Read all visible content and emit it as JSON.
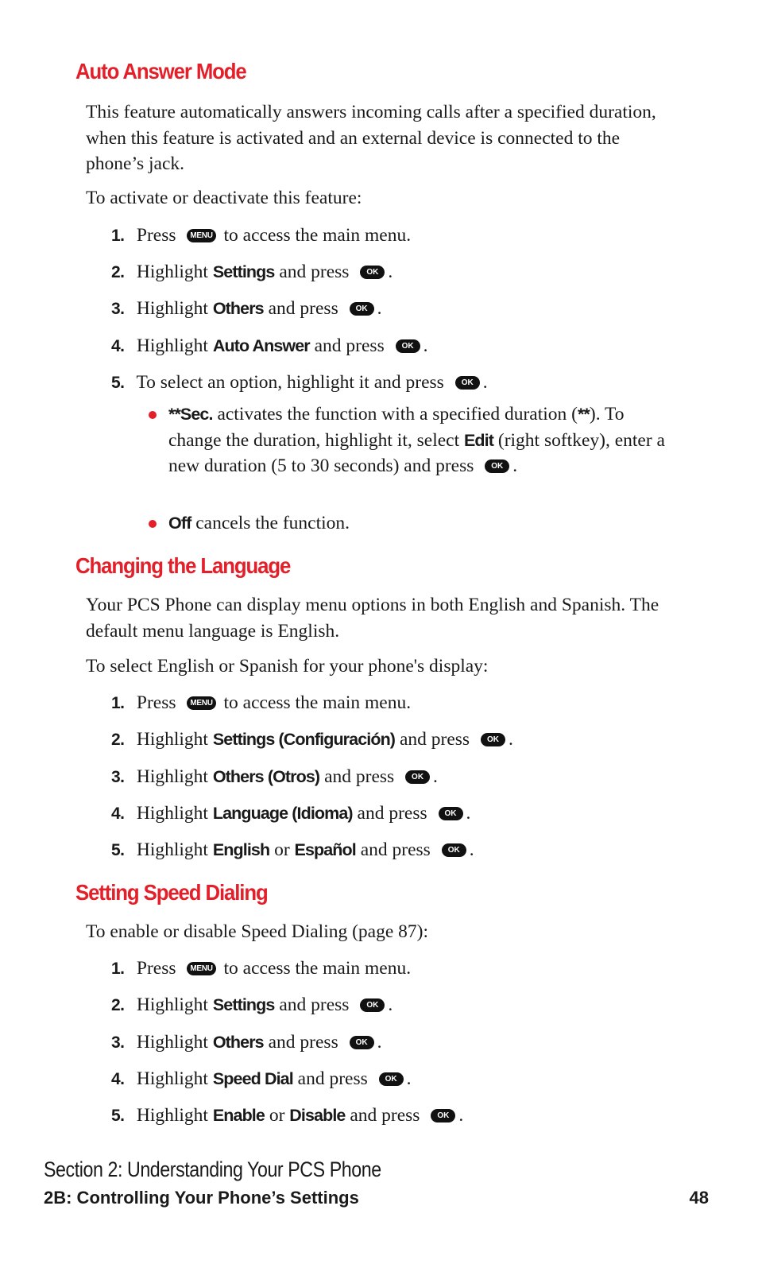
{
  "keys": {
    "menu": "MENU",
    "ok": "OK"
  },
  "sections": [
    {
      "title": "Auto Answer Mode",
      "intro": "This feature automatically answers incoming calls after a specified duration, when this feature is activated and an external device is connected to the phone’s jack.",
      "lead": "To activate or deactivate this feature:",
      "steps": [
        {
          "num": "1.",
          "pre": "Press",
          "post": "to access the main menu."
        },
        {
          "num": "2.",
          "pre": "Highlight",
          "bold": "Settings",
          "post": "and press"
        },
        {
          "num": "3.",
          "pre": "Highlight",
          "bold": "Others",
          "post": "and press"
        },
        {
          "num": "4.",
          "pre": "Highlight",
          "bold": "Auto Answer",
          "post": "and press"
        },
        {
          "num": "5.",
          "pre": "To select an option, highlight it and press"
        }
      ],
      "bullets": [
        {
          "bold": "**Sec.",
          "text1": "activates the function with a specified duration (",
          "bold2": "**",
          "text2": "). To change the duration, highlight it, select",
          "bold3": "Edit",
          "text3": "(right softkey), enter a new duration (5 to 30 seconds) and press"
        },
        {
          "bold": "Off",
          "text1": "cancels the function."
        }
      ]
    },
    {
      "title": "Changing the Language",
      "intro": "Your PCS Phone can display menu options in both English and Spanish. The default menu language is English.",
      "lead": "To select English or Spanish for your phone's display:",
      "steps": [
        {
          "num": "1.",
          "pre": "Press",
          "post": "to access the main menu."
        },
        {
          "num": "2.",
          "pre": "Highlight",
          "bold": "Settings (Configuración)",
          "post": "and press"
        },
        {
          "num": "3.",
          "pre": "Highlight",
          "bold": "Others (Otros)",
          "post": "and press"
        },
        {
          "num": "4.",
          "pre": "Highlight",
          "bold": "Language (Idioma)",
          "post": "and press"
        },
        {
          "num": "5.",
          "pre": "Highlight",
          "bold": "English",
          "mid": "or",
          "bold2": "Español",
          "post": "and press"
        }
      ]
    },
    {
      "title": "Setting Speed Dialing",
      "lead": "To enable or disable Speed Dialing (page 87):",
      "steps": [
        {
          "num": "1.",
          "pre": "Press",
          "post": "to access the main menu."
        },
        {
          "num": "2.",
          "pre": "Highlight",
          "bold": "Settings",
          "post": "and press"
        },
        {
          "num": "3.",
          "pre": "Highlight",
          "bold": "Others",
          "post": "and press"
        },
        {
          "num": "4.",
          "pre": "Highlight",
          "bold": "Speed Dial",
          "post": "and press"
        },
        {
          "num": "5.",
          "pre": "Highlight",
          "bold": "Enable",
          "mid": "or",
          "bold2": "Disable",
          "post": "and press"
        }
      ]
    }
  ],
  "footer": {
    "section": "Section 2: Understanding Your PCS Phone",
    "chapter": "2B: Controlling Your Phone’s Settings",
    "page_number": "48"
  },
  "colors": {
    "heading": "#e3202a",
    "bullet": "#e3202a",
    "key_bg": "#111111"
  }
}
